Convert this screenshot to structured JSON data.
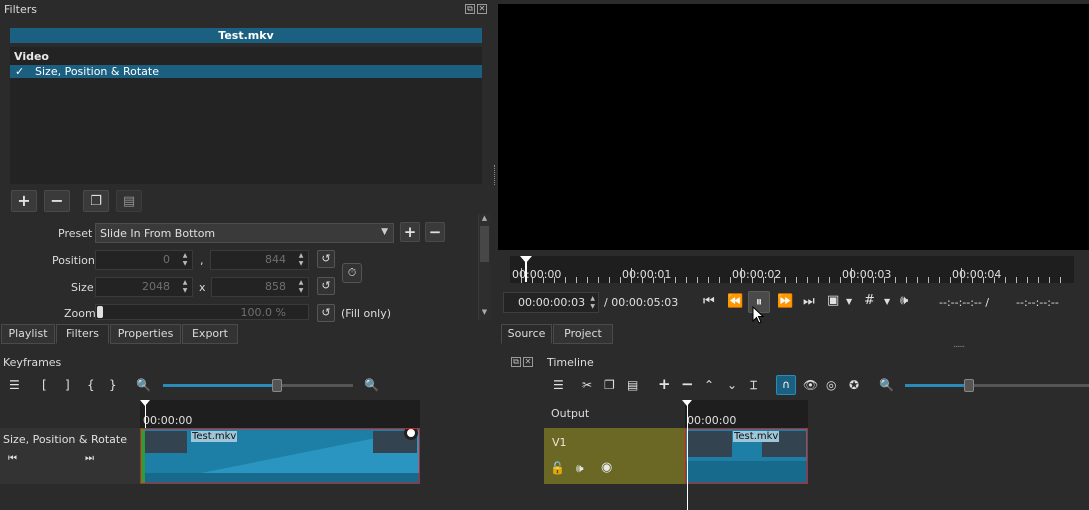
{
  "filters_panel": {
    "title": "Filters",
    "clip_name": "Test.mkv",
    "section": "Video",
    "filter_item": "Size, Position & Rotate",
    "check_mark": "✓",
    "preset_label": "Preset",
    "preset_value": "Slide In From Bottom",
    "position_label": "Position",
    "position_x": "0",
    "position_sep": ",",
    "position_y": "844",
    "size_label": "Size",
    "size_w": "2048",
    "size_sep": "x",
    "size_h": "858",
    "zoom_label": "Zoom",
    "zoom_value": "100.0 %",
    "fill_only": "(Fill only)"
  },
  "left_tabs": [
    "Playlist",
    "Filters",
    "Properties",
    "Export"
  ],
  "player": {
    "ruler_ticks": [
      "00:00:00",
      "00:00:01",
      "00:00:02",
      "00:00:03",
      "00:00:04"
    ],
    "current_time": "00:00:00:03",
    "duration": "/ 00:00:05:03",
    "in_point": "--:--:--:-- /",
    "out_point": "--:--:--:--",
    "tabs": [
      "Source",
      "Project"
    ],
    "dots": "......"
  },
  "keyframes": {
    "title": "Keyframes",
    "tools": [
      "[",
      "]",
      "{",
      "}"
    ],
    "time": "00:00:00",
    "track_label": "Size, Position & Rotate",
    "clip_name": "Test.mkv",
    "zoom_slider": 0.6
  },
  "timeline": {
    "title": "Timeline",
    "time": "00:00:00",
    "output_label": "Output",
    "track_name": "V1",
    "clip_name": "Test.mkv",
    "zoom_slider": 0.35
  },
  "colors": {
    "accent": "#1b6080",
    "clip_blue": "#1e7fa6",
    "track_olive": "#6a6824",
    "clip_border": "#d02020"
  },
  "icons": [
    "plus-icon",
    "minus-icon",
    "copy-icon",
    "paste-icon",
    "chevron-down-icon",
    "reset-icon",
    "stopwatch-icon",
    "skip-start-icon",
    "rewind-icon",
    "pause-icon",
    "fast-forward-icon",
    "skip-end-icon",
    "zoom-icon",
    "grid-icon",
    "volume-icon",
    "menu-icon",
    "cut-icon",
    "append-icon",
    "lift-icon",
    "overwrite-icon",
    "split-icon",
    "snap-icon",
    "ripple-icon",
    "zoom-out-icon",
    "zoom-in-icon",
    "lock-icon",
    "mute-icon",
    "eye-icon"
  ]
}
